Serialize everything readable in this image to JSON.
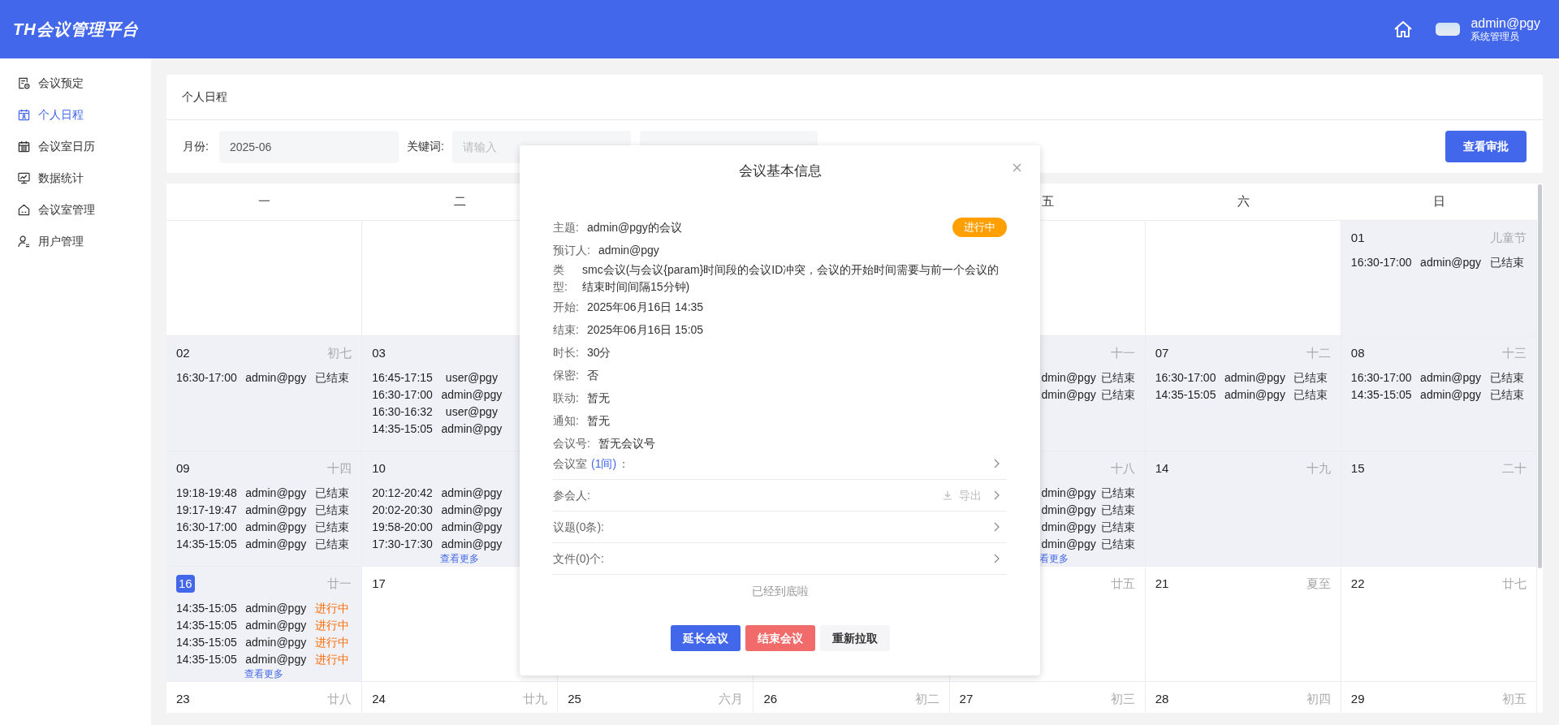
{
  "header": {
    "logo": "TH会议管理平台",
    "user_name": "admin@pgy",
    "user_role": "系统管理员"
  },
  "sidebar": {
    "items": [
      {
        "label": "会议预定",
        "selected": false
      },
      {
        "label": "个人日程",
        "selected": true
      },
      {
        "label": "会议室日历",
        "selected": false
      },
      {
        "label": "数据统计",
        "selected": false
      },
      {
        "label": "会议室管理",
        "selected": false
      },
      {
        "label": "用户管理",
        "selected": false
      }
    ]
  },
  "page": {
    "title": "个人日程"
  },
  "filters": {
    "month_label": "月份:",
    "month_value": "2025-06",
    "keyword_label": "关键词:",
    "keyword_placeholder": "请输入",
    "approval_button": "查看审批"
  },
  "calendar": {
    "weekdays": [
      "一",
      "二",
      "五",
      "六",
      "日"
    ],
    "weeks": [
      [
        {
          "day": "01",
          "lunar": "儿童节",
          "past": true,
          "today": false,
          "events": [
            {
              "time": "16:30-17:00",
              "user": "admin@pgy",
              "status": "已结束",
              "ongoing": false
            }
          ]
        }
      ],
      [
        {
          "day": "02",
          "lunar": "初七",
          "past": true,
          "today": false,
          "events": [
            {
              "time": "16:30-17:00",
              "user": "admin@pgy",
              "status": "已结束",
              "ongoing": false
            }
          ]
        },
        {
          "day": "03",
          "past": true,
          "today": false,
          "events": [
            {
              "time": "16:45-17:15",
              "user": "user@pgy"
            },
            {
              "time": "16:30-17:00",
              "user": "admin@pgy"
            },
            {
              "time": "16:30-16:32",
              "user": "user@pgy"
            },
            {
              "time": "14:35-15:05",
              "user": "admin@pgy"
            }
          ]
        },
        {
          "lunar": "十一",
          "past": true,
          "events": [
            {
              "user": "dmin@pgy",
              "status": "已结束",
              "ongoing": false
            },
            {
              "user": "dmin@pgy",
              "status": "已结束",
              "ongoing": false
            }
          ]
        },
        {
          "day": "07",
          "lunar": "十二",
          "past": true,
          "today": false,
          "events": [
            {
              "time": "16:30-17:00",
              "user": "admin@pgy",
              "status": "已结束",
              "ongoing": false
            },
            {
              "time": "14:35-15:05",
              "user": "admin@pgy",
              "status": "已结束",
              "ongoing": false
            }
          ]
        },
        {
          "day": "08",
          "lunar": "十三",
          "past": true,
          "today": false,
          "events": [
            {
              "time": "16:30-17:00",
              "user": "admin@pgy",
              "status": "已结束",
              "ongoing": false
            },
            {
              "time": "14:35-15:05",
              "user": "admin@pgy",
              "status": "已结束",
              "ongoing": false
            }
          ]
        }
      ],
      [
        {
          "day": "09",
          "lunar": "十四",
          "past": true,
          "today": false,
          "events": [
            {
              "time": "19:18-19:48",
              "user": "admin@pgy",
              "status": "已结束",
              "ongoing": false
            },
            {
              "time": "19:17-19:47",
              "user": "admin@pgy",
              "status": "已结束",
              "ongoing": false
            },
            {
              "time": "16:30-17:00",
              "user": "admin@pgy",
              "status": "已结束",
              "ongoing": false
            },
            {
              "time": "14:35-15:05",
              "user": "admin@pgy",
              "status": "已结束",
              "ongoing": false
            }
          ]
        },
        {
          "day": "10",
          "past": true,
          "today": false,
          "events": [
            {
              "time": "20:12-20:42",
              "user": "admin@pgy"
            },
            {
              "time": "20:02-20:30",
              "user": "admin@pgy"
            },
            {
              "time": "19:58-20:00",
              "user": "admin@pgy"
            },
            {
              "time": "17:30-17:30",
              "user": "admin@pgy"
            }
          ],
          "more": "查看更多"
        },
        {
          "lunar": "十八",
          "past": true,
          "events": [
            {
              "user": "dmin@pgy",
              "status": "已结束",
              "ongoing": false
            },
            {
              "user": "dmin@pgy",
              "status": "已结束",
              "ongoing": false
            },
            {
              "user": "dmin@pgy",
              "status": "已结束",
              "ongoing": false
            },
            {
              "user": "dmin@pgy",
              "status": "已结束",
              "ongoing": false
            }
          ],
          "more": "看更多"
        },
        {
          "day": "14",
          "lunar": "十九",
          "past": true,
          "today": false
        },
        {
          "day": "15",
          "lunar": "二十",
          "past": true,
          "today": false
        }
      ],
      [
        {
          "day": "16",
          "lunar": "廿一",
          "past": true,
          "today": true,
          "events": [
            {
              "time": "14:35-15:05",
              "user": "admin@pgy",
              "status": "进行中",
              "ongoing": true
            },
            {
              "time": "14:35-15:05",
              "user": "admin@pgy",
              "status": "进行中",
              "ongoing": true
            },
            {
              "time": "14:35-15:05",
              "user": "admin@pgy",
              "status": "进行中",
              "ongoing": true
            },
            {
              "time": "14:35-15:05",
              "user": "admin@pgy",
              "status": "进行中",
              "ongoing": true
            }
          ],
          "more": "查看更多"
        },
        {
          "day": "17",
          "past": false,
          "today": false
        },
        {
          "lunar": "廿五",
          "past": false
        },
        {
          "day": "21",
          "lunar": "夏至",
          "past": false,
          "today": false
        },
        {
          "day": "22",
          "lunar": "廿七",
          "past": false,
          "today": false
        }
      ],
      [
        {
          "day": "23",
          "lunar": "廿八",
          "past": false,
          "today": false
        },
        {
          "day": "24",
          "lunar": "廿九",
          "past": false,
          "today": false
        },
        {
          "day": "25",
          "lunar": "六月",
          "past": false,
          "today": false
        },
        {
          "day": "26",
          "lunar": "初二",
          "past": false,
          "today": false
        },
        {
          "day": "27",
          "lunar": "初三",
          "past": false,
          "today": false
        },
        {
          "day": "28",
          "lunar": "初四",
          "past": false,
          "today": false
        },
        {
          "day": "29",
          "lunar": "初五",
          "past": false,
          "today": false
        }
      ]
    ]
  },
  "dialog": {
    "title": "会议基本信息",
    "status": "进行中",
    "ongoing": true,
    "fields": [
      {
        "label": "主题:",
        "value": "admin@pgy的会议"
      },
      {
        "label": "预订人:",
        "value": "admin@pgy"
      },
      {
        "label": "类型:",
        "value": "smc会议(与会议{param}时间段的会议ID冲突，会议的开始时间需要与前一个会议的结束时间间隔15分钟)"
      },
      {
        "label": "开始:",
        "value": "2025年06月16日 14:35"
      },
      {
        "label": "结束:",
        "value": "2025年06月16日 15:05"
      },
      {
        "label": "时长:",
        "value": "30分"
      },
      {
        "label": "保密:",
        "value": "否"
      },
      {
        "label": "联动:",
        "value": "暂无"
      },
      {
        "label": "通知:",
        "value": "暂无"
      },
      {
        "label": "会议号:",
        "value": "暂无会议号"
      }
    ],
    "sections": [
      {
        "label": "会议室",
        "count": "(1间)",
        "tail": "："
      },
      {
        "label": "参会人:",
        "action": "导出"
      },
      {
        "label": "议题(0条):"
      },
      {
        "label": "文件(0)个:"
      }
    ],
    "end_note": "已经到底啦",
    "buttons": [
      {
        "label": "延长会议",
        "kind": "primary"
      },
      {
        "label": "结束会议",
        "kind": "danger"
      },
      {
        "label": "重新拉取",
        "kind": "plain"
      }
    ]
  }
}
